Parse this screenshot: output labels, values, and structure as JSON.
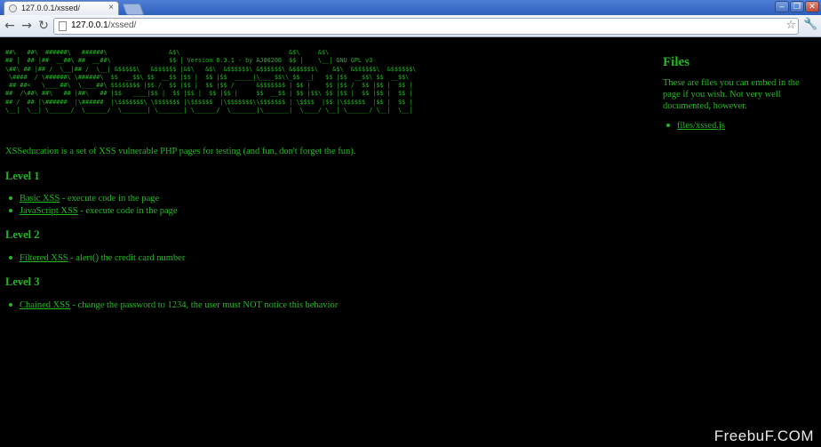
{
  "browser": {
    "tab_title": "127.0.0.1/xssed/",
    "tab_close": "×",
    "url_host": "127.0.0.1",
    "url_path": "/xssed/",
    "back_glyph": "←",
    "forward_glyph": "→",
    "reload_glyph": "↻",
    "star_glyph": "☆",
    "wrench_glyph": "🔧",
    "minimize_glyph": "–",
    "maximize_glyph": "❐",
    "close_glyph": "✕"
  },
  "page": {
    "banner_lines": [
      "##\\   ##\\  ######\\   ######\\                 &$\\                              &$\\     &$\\",
      "## |  ## |##  __##\\ ##  __##\\                $$ | Version 0.3.1 - by AJ00200  $$ |    \\__| GNU GPL v3",
      "\\##\\ ## |## /  \\__|## /  \\__| &$$$$$\\   &$$$$$$ |&$\\   &$\\  &$$$$$$\\ &$$$$$$\\ &$$$$$$\\    &$\\  &$$$$$$\\  &$$$$$$\\",
      " \\####  / \\######\\ \\######\\  $$  __$$\\ $$  __$$ |$$ |  $$ |$$  _____|\\____$$\\\\_$$  _|   $$ |$$  __$$\\ $$  __$$\\",
      " ## ##<   \\____##\\  \\____##\\ $$$$$$$$ |$$ /  $$ |$$ |  $$ |$$ /      &$$$$$$$ | $$ |    $$ |$$ /  $$ |$$ |  $$ |",
      "##  /\\##\\ ##\\   ## |##\\   ## |$$   ____|$$ |  $$ |$$ |  $$ |$$ |     $$  __$$ | $$ |$$\\ $$ |$$ |  $$ |$$ |  $$ |",
      "## /  ## |\\######  |\\######  |\\$$$$$$$\\ \\$$$$$$$ |\\$$$$$$  |\\$$$$$$$\\\\$$$$$$$ | \\$$$$  |$$ |\\$$$$$$  |$$ |  $$ |",
      "\\__|  \\__| \\______/  \\______/  \\_______| \\_______| \\______/  \\_______|\\_______|  \\____/ \\__| \\______/ \\__|  \\__|"
    ],
    "intro": "XSSeducation is a set of XSS vulnerable PHP pages for testing (and fun, don't forget the fun).",
    "levels": [
      {
        "title": "Level 1",
        "items": [
          {
            "link": "Basic XSS",
            "desc": " - execute code in the page"
          },
          {
            "link": "JavaScript XSS",
            "desc": " - execute code in the page"
          }
        ]
      },
      {
        "title": "Level 2",
        "items": [
          {
            "link": "Filtered XSS",
            "desc": " - alert() the credit card number"
          }
        ]
      },
      {
        "title": "Level 3",
        "items": [
          {
            "link": "Chained XSS",
            "desc": " - change the password to 1234, the user must NOT notice this behavior"
          }
        ]
      }
    ],
    "files": {
      "title": "Files",
      "desc": "These are files you can embed in the page if you wish. Not very well documented, however.",
      "items": [
        "files/xssed.js"
      ]
    }
  },
  "watermark": "FreebuF.COM",
  "colors": {
    "text_green": "#22b822",
    "background": "#000000",
    "chrome_blue": "#3b6cc8"
  }
}
